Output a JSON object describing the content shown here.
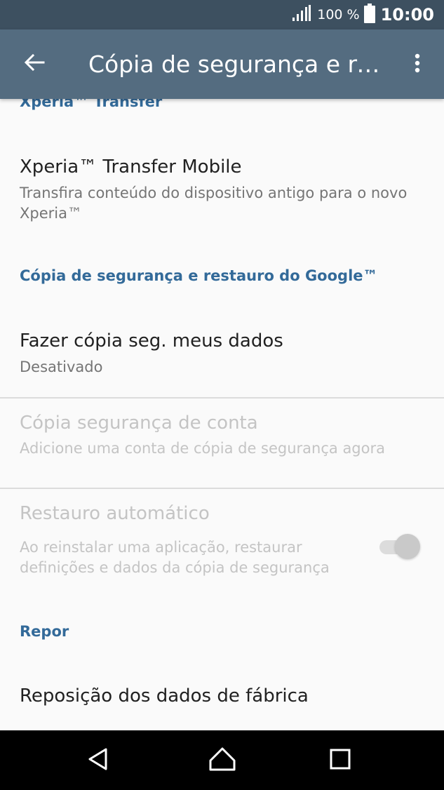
{
  "status_bar": {
    "battery_percent": "100 %",
    "time": "10:00",
    "icons": [
      "signal-icon",
      "battery-icon"
    ]
  },
  "app_bar": {
    "title": "Cópia de segurança e restauro",
    "icons": [
      "back-arrow-icon",
      "more-vert-icon"
    ]
  },
  "sections": {
    "xperia_header": "Xperia™ Transfer",
    "google_header": "Cópia de segurança e restauro do Google™",
    "reset_header": "Repor"
  },
  "items": {
    "transfer": {
      "title": "Xperia™ Transfer Mobile",
      "subtitle": "Transfira conteúdo do dispositivo antigo para o novo Xperia™"
    },
    "backup_data": {
      "title": "Fazer cópia seg. meus dados",
      "subtitle": "Desativado"
    },
    "backup_account": {
      "title": "Cópia segurança de conta",
      "subtitle": "Adicione uma conta de cópia de segurança agora"
    },
    "auto_restore": {
      "title": "Restauro automático",
      "subtitle": "Ao reinstalar uma aplicação, restaurar definições e dados da cópia de segurança",
      "enabled": true,
      "disabled_state": true
    },
    "factory_reset": {
      "title": "Reposição dos dados de fábrica"
    }
  },
  "nav_bar": {
    "icons": [
      "back-icon",
      "home-icon",
      "recents-icon"
    ]
  },
  "colors": {
    "status_bar": "#3d5060",
    "app_bar": "#546c80",
    "accent": "#336a99",
    "background": "#fafafa",
    "disabled_text": "#c4c4c4"
  }
}
